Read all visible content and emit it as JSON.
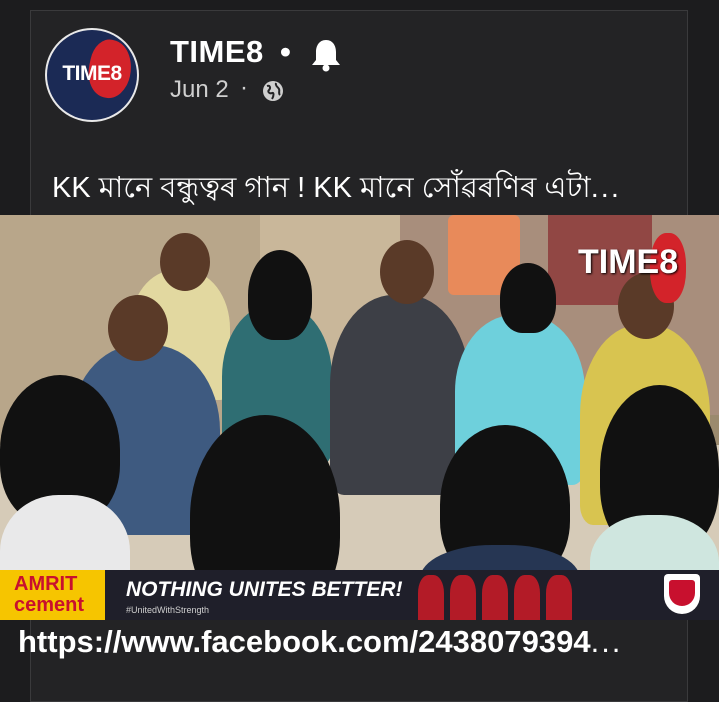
{
  "post": {
    "avatar_text": "TIME8",
    "page_name": "TIME8",
    "separator": "•",
    "notification_icon": "bell-icon",
    "date": "Jun 2",
    "date_separator": "·",
    "audience_icon": "globe-icon",
    "caption": "KK মানে বন্ধুত্বৰ গান ! KK মানে সোঁৱৰণিৰ এটা",
    "caption_more": "...",
    "video_watermark": "TIME8",
    "ad": {
      "brand_line1": "AMRIT",
      "brand_line2": "cement",
      "slogan": "NOTHING UNITES BETTER!",
      "hashtag": "#UnitedWithStrength"
    },
    "link": "https://www.facebook.com/2438079394",
    "link_more": "..."
  },
  "colors": {
    "background": "#1c1c1e",
    "card": "#232325",
    "brand_red": "#d3232a",
    "avatar_navy": "#1b2a55",
    "ad_yellow": "#f6c500"
  }
}
